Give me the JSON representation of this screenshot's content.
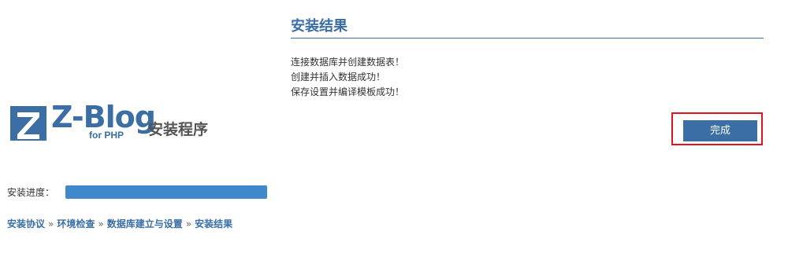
{
  "logo": {
    "brand": "Z-Blog",
    "sub": "for PHP",
    "installer_label": "安装程序"
  },
  "progress": {
    "label": "安装进度：",
    "percent": 100
  },
  "steps": [
    "安装协议",
    "环境检查",
    "数据库建立与设置",
    "安装结果"
  ],
  "steps_separator": "»",
  "result": {
    "title": "安装结果",
    "messages": [
      "连接数据库并创建数据表！",
      "创建并插入数据成功！",
      "保存设置并编译模板成功！"
    ],
    "finish_label": "完成"
  },
  "colors": {
    "brand_blue": "#3a6ea5",
    "progress_blue": "#3f88cc",
    "highlight_red": "#e0141e"
  }
}
